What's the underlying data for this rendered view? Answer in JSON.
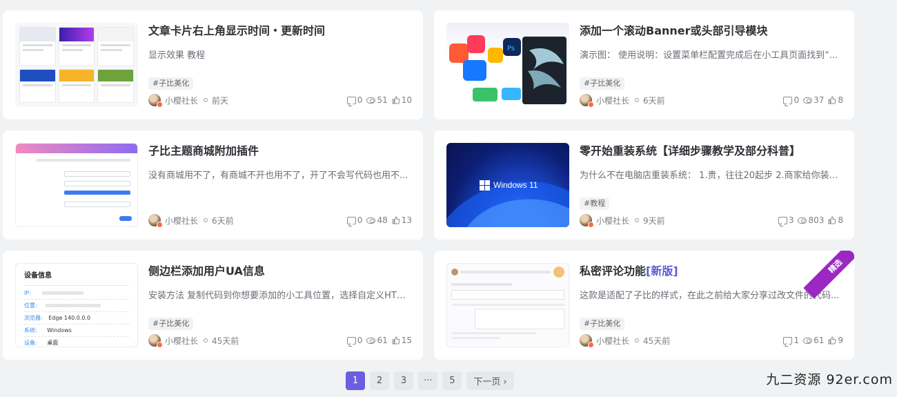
{
  "cards": [
    {
      "title": "文章卡片右上角显示时间・更新时间",
      "excerpt": "显示效果 教程",
      "tag": "#子比美化",
      "author": "小樱社长",
      "time": "前天",
      "comments": "0",
      "views": "51",
      "likes": "10",
      "thumb_text": ""
    },
    {
      "title": "添加一个滚动Banner或头部引导模块",
      "excerpt": "演示图： 使用说明：设置菜单栏配置完成后在小工具页面找到“...",
      "tag": "#子比美化",
      "author": "小樱社长",
      "time": "6天前",
      "comments": "0",
      "views": "37",
      "likes": "8",
      "thumb_text": ""
    },
    {
      "title": "子比主题商城附加插件",
      "excerpt": "没有商城用不了，有商城不开也用不了，开了不会写代码也用不...",
      "tag": "",
      "author": "小樱社长",
      "time": "6天前",
      "comments": "0",
      "views": "48",
      "likes": "13",
      "thumb_text": ""
    },
    {
      "title": "零开始重装系统【详细步骤教学及部分科普】",
      "excerpt": "为什么不在电脑店重装系统： 1.贵，往往20起步 2.商家给你装的...",
      "tag": "#教程",
      "author": "小樱社长",
      "time": "9天前",
      "comments": "3",
      "views": "803",
      "likes": "8",
      "thumb_text": "Windows 11"
    },
    {
      "title": "侧边栏添加用户UA信息",
      "excerpt": "安装方法 复制代码到你想要添加的小工具位置，选择自定义HTM...",
      "tag": "#子比美化",
      "author": "小樱社长",
      "time": "45天前",
      "comments": "0",
      "views": "61",
      "likes": "15",
      "thumb_text": "设备信息",
      "thumb_rows": [
        [
          "IP:",
          ""
        ],
        [
          "位置:",
          ""
        ],
        [
          "浏览器:",
          "Edge 140.0.0.0"
        ],
        [
          "系统:",
          "Windows"
        ],
        [
          "设备:",
          "桌面"
        ]
      ]
    },
    {
      "title": "私密评论功能",
      "title_hl": "[新版]",
      "excerpt": "这款是适配了子比的样式，在此之前给大家分享过改文件的代码...",
      "tag": "#子比美化",
      "author": "小樱社长",
      "time": "45天前",
      "comments": "1",
      "views": "61",
      "likes": "9",
      "ribbon": "精选",
      "thumb_text": ""
    }
  ],
  "pagination": {
    "pages": [
      "1",
      "2",
      "3",
      "···",
      "5"
    ],
    "next": "下一页 ›",
    "current": "1"
  },
  "watermark": "九二资源 92er.com",
  "colors": {
    "accent": "#6b5fe0",
    "ribbon": "#9b28c3",
    "title_highlight": "#5b5bd6"
  }
}
